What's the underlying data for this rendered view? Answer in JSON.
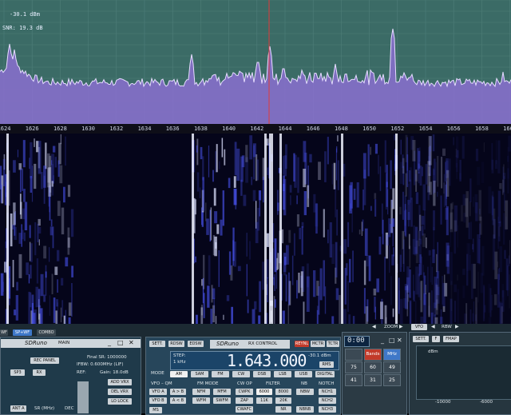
{
  "spectrum": {
    "level_readout": "-30.1 dBm",
    "snr_readout": "SNR: 19.3 dB",
    "freq_ticks": [
      "1624",
      "1626",
      "1628",
      "1630",
      "1632",
      "1634",
      "1636",
      "1638",
      "1640",
      "1642",
      "1644",
      "1646",
      "1648",
      "1650",
      "1652",
      "1654",
      "1656",
      "1658",
      "1660"
    ]
  },
  "toolbar_left": {
    "wf_label": "WF",
    "spwf_label": "SP+WF",
    "combo_label": "COMBO"
  },
  "toolbar_right": {
    "zoom_label": "ZOOM",
    "vfo_label": "VFO",
    "rbw_label": "RBW"
  },
  "main_panel": {
    "title": "SDRuno",
    "subtitle": "MAIN",
    "rec_panel": "REC PANEL",
    "sp3": "SP3",
    "rx": "RX",
    "final_sr": "Final SR: 1000000",
    "ifbw": "IFBW: 0.600MHz (LIF)",
    "ref": "REF:",
    "gain": "Gain: 18.0dB",
    "add_vrx": "ADD VRX",
    "del_vrx": "DEL VRX",
    "lo_lock": "LO LOCK",
    "ant_a": "ANT A",
    "sr_mhz": "SR (MHz)",
    "sr_val": "2.0",
    "dec": "DEC",
    "dec_val": "2"
  },
  "rx_control": {
    "sett": "SETT.",
    "rdsw": "RDSW",
    "edsw": "EDSW",
    "title": "SDRuno",
    "subtitle": "RX CONTROL",
    "reyn": "REYNL",
    "mctr": "MCTR",
    "tctr": "TCTR",
    "step": "STEP:",
    "step_val": "1 kHz",
    "frequency": "1.643.000",
    "level": "-30.1 dBm",
    "rms": "RMS",
    "mode_lbl": "MODE",
    "modes": [
      "AM",
      "SAM",
      "FM",
      "CW",
      "DSB",
      "LSB",
      "USB",
      "DIGITAL"
    ],
    "vfo_qm": "VFO – QM",
    "vfo_a": "VFO A",
    "vfo_b": "VFO B",
    "a_b": "A > B",
    "b_a": "A < B",
    "fm_mode": "FM MODE",
    "nfm": "NFM",
    "mfm": "MFM",
    "wfm": "WFM",
    "swfm": "SWFM",
    "cw_op": "CW OP",
    "cwpk": "CWPK",
    "zap": "ZAP",
    "cwafc": "CWAFC",
    "filter": "FILTER",
    "f6000": "6000",
    "f8000": "8000",
    "f11k": "11K",
    "f20k": "20K",
    "nr": "NR",
    "nb": "NB",
    "nbw": "NBW",
    "nbnb": "NBNB",
    "notch": "NOTCH",
    "nch1": "NCH1",
    "nch2": "NCH2",
    "nch3": "NCH3",
    "ms_lbl": "MS"
  },
  "keypad": {
    "time": "0:00",
    "bands": "Bands",
    "mhz": "MHz",
    "keys": [
      "75",
      "60",
      "49",
      "41",
      "31",
      "25"
    ]
  },
  "spectrum_panel": {
    "sett": "SETT.",
    "f": "F",
    "fmap": "FMAP",
    "unit": "dBm",
    "xticks": [
      "-10000",
      "-6000"
    ]
  }
}
